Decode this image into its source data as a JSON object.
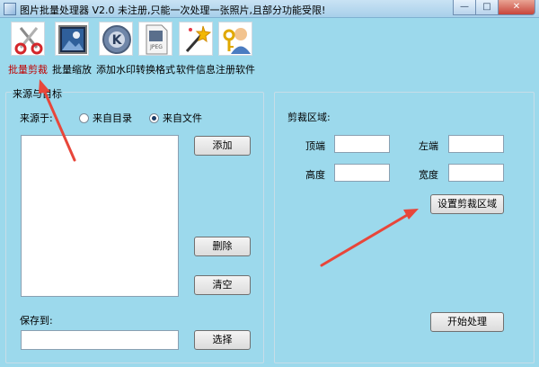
{
  "window": {
    "title": "图片批量处理器 V2.0  未注册,只能一次处理一张照片,且部分功能受限!",
    "minimize_label": "—",
    "maximize_label": "□",
    "close_label": "✕"
  },
  "toolbar": {
    "items": [
      {
        "label": "批量剪裁",
        "icon": "scissors-icon",
        "active": true
      },
      {
        "label": "批量缩放",
        "icon": "picture-icon"
      },
      {
        "label": "添加水印",
        "icon": "watermark-k-icon"
      },
      {
        "label": "转换格式",
        "icon": "jpeg-file-icon"
      },
      {
        "label": "软件信息",
        "icon": "magic-wand-icon"
      },
      {
        "label": "注册软件",
        "icon": "user-key-icon"
      }
    ],
    "active_color": "#c00000"
  },
  "source_panel": {
    "title": "来源与目标",
    "source_label": "来源于:",
    "radio_dir": "来自目录",
    "radio_file": "来自文件",
    "selected": "来自文件",
    "add_button": "添加",
    "delete_button": "删除",
    "clear_button": "清空",
    "save_label": "保存到:",
    "save_value": "",
    "select_button": "选择"
  },
  "crop_panel": {
    "title": "剪裁区域:",
    "top_label": "顶端",
    "left_label": "左端",
    "height_label": "高度",
    "width_label": "宽度",
    "top_value": "",
    "left_value": "",
    "height_value": "",
    "width_value": "",
    "set_button": "设置剪裁区域",
    "start_button": "开始处理"
  },
  "colors": {
    "background": "#9cd9ec",
    "arrow": "#e8463a"
  }
}
